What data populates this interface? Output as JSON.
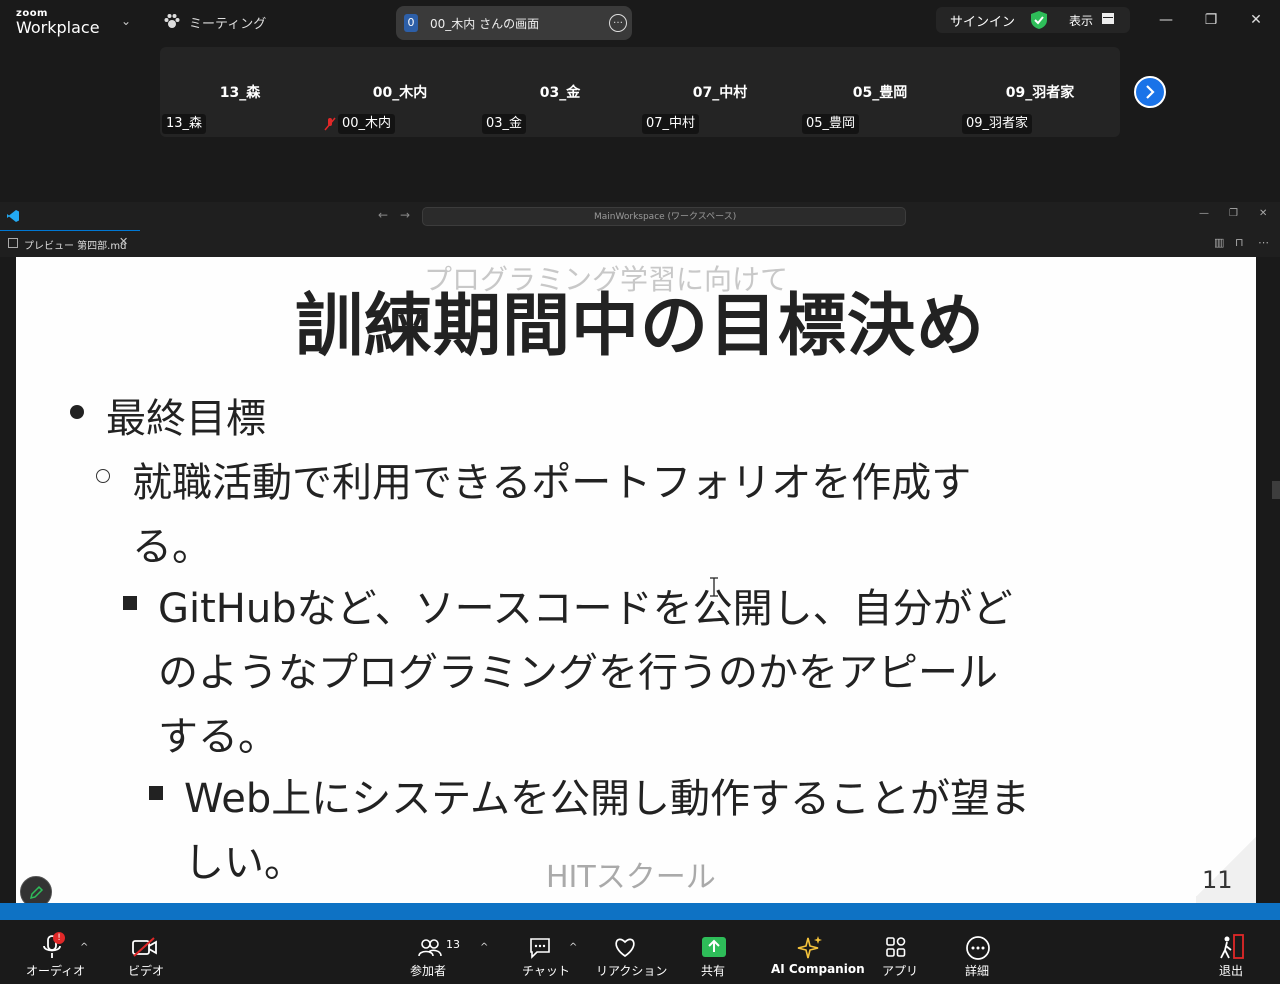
{
  "zoom": {
    "brand_small": "zoom",
    "brand_big": "Workplace",
    "meeting_label": "ミーティング",
    "share_count": "0",
    "share_label": "00_木内 さんの画面",
    "signin_label": "サインイン",
    "view_label": "表示"
  },
  "participants": [
    {
      "name": "13_森",
      "tag": "13_森"
    },
    {
      "name": "00_木内",
      "tag": "00_木内",
      "muted": true
    },
    {
      "name": "03_金",
      "tag": "03_金"
    },
    {
      "name": "07_中村",
      "tag": "07_中村"
    },
    {
      "name": "05_豊岡",
      "tag": "05_豊岡"
    },
    {
      "name": "09_羽者家",
      "tag": "09_羽者家"
    }
  ],
  "vscode": {
    "search_text": "MainWorkspace (ワークスペース)",
    "tab_label": "プレビュー 第四部.md"
  },
  "slide": {
    "subtitle": "プログラミング学習に向けて",
    "title": "訓練期間中の目標決め",
    "l1": "最終目標",
    "l2a": "就職活動で利用できるポートフォリオを作成す",
    "l2b": "る。",
    "l3a": "GitHubなど、ソースコードを公開し、自分がど",
    "l3b": "のようなプログラミングを行うのかをアピール",
    "l3c": "する。",
    "l4a": "Web上にシステムを公開し動作することが望ま",
    "l4b": "しい。",
    "footer": "HITスクール",
    "page": "11"
  },
  "controls": {
    "audio": "オーディオ",
    "video": "ビデオ",
    "participants": "参加者",
    "participants_count": "13",
    "chat": "チャット",
    "reactions": "リアクション",
    "share": "共有",
    "ai": "AI Companion",
    "apps": "アプリ",
    "more": "詳細",
    "leave": "退出"
  }
}
